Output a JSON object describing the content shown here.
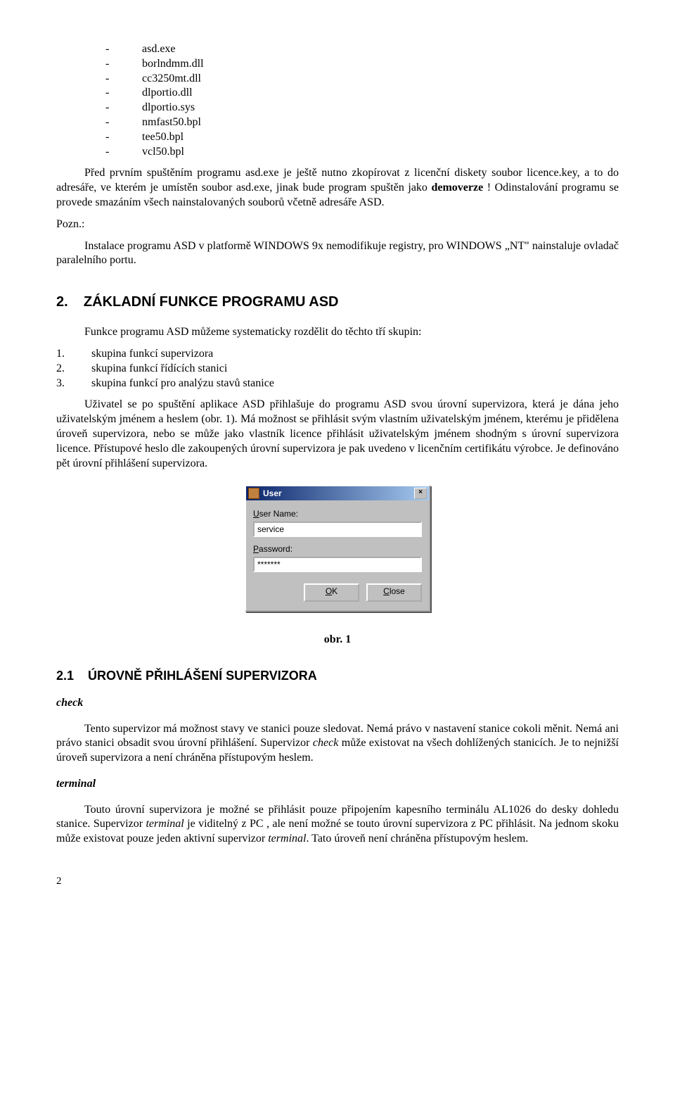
{
  "file_list": [
    "asd.exe",
    "borlndmm.dll",
    "cc3250mt.dll",
    "dlportio.dll",
    "dlportio.sys",
    "nmfast50.bpl",
    "tee50.bpl",
    "vcl50.bpl"
  ],
  "para1_a": "Před prvním spuštěním programu asd.exe je ještě nutno zkopírovat z licenční diskety soubor licence.key, a to do adresáře, ve kterém je umístěn soubor asd.exe, jinak bude program spuštěn jako ",
  "para1_bold": "demoverze",
  "para1_b": " ! Odinstalování programu se provede smazáním všech nainstalovaných souborů včetně adresáře ASD.",
  "pozn": "Pozn.:",
  "para2": "Instalace programu ASD v platformě WINDOWS 9x nemodifikuje registry, pro WINDOWS „NT\" nainstaluje ovladač paralelního portu.",
  "section2_num": "2.",
  "section2_title": "ZÁKLADNÍ FUNKCE PROGRAMU ASD",
  "intro_groups": "Funkce programu ASD můžeme systematicky rozdělit do těchto tří skupin:",
  "group_items": [
    "skupina funkcí supervizora",
    "skupina funkcí řídících stanici",
    "skupina funkcí pro analýzu stavů stanice"
  ],
  "para3": "Uživatel se po spuštění aplikace ASD přihlašuje do programu ASD svou úrovní supervizora, která je dána jeho uživatelským jménem a heslem (obr. 1). Má možnost se přihlásit svým vlastním uživatelským jménem, kterému je přidělena úroveň supervizora, nebo se může jako vlastník licence přihlásit uživatelským jménem shodným s úrovní supervizora licence. Přístupové heslo dle zakoupených úrovní supervizora je pak uvedeno v licenčním certifikátu výrobce. Je definováno pět úrovní přihlášení supervizora.",
  "dialog": {
    "title": "User",
    "username_label_u": "U",
    "username_label_rest": "ser Name:",
    "username_value": "service",
    "password_label_u": "P",
    "password_label_rest": "assword:",
    "password_value": "*******",
    "ok_u": "O",
    "ok_rest": "K",
    "close_u": "C",
    "close_rest": "lose",
    "close_x": "×"
  },
  "caption1": "obr. 1",
  "section21_num": "2.1",
  "section21_title": "ÚROVNĚ PŘIHLÁŠENÍ SUPERVIZORA",
  "check_head": "check",
  "check_text_a": "Tento supervizor má možnost stavy ve stanici pouze sledovat. Nemá právo v nastavení stanice cokoli měnit. Nemá ani právo stanici obsadit svou úrovní přihlášení. Supervizor ",
  "check_text_i": "check",
  "check_text_b": " může existovat na všech dohlížených stanicích. Je to nejnižší úroveň supervizora a není chráněna přístupovým heslem.",
  "terminal_head": "terminal",
  "terminal_text_a": "Touto úrovní supervizora je možné se přihlásit pouze připojením kapesního terminálu AL1026 do desky dohledu stanice. Supervizor ",
  "terminal_text_i1": "terminal",
  "terminal_text_b": " je viditelný z PC , ale není možné se touto úrovní supervizora z PC přihlásit. Na jednom skoku může existovat pouze jeden aktivní supervizor ",
  "terminal_text_i2": "terminal",
  "terminal_text_c": ". Tato úroveň není chráněna přístupovým heslem.",
  "page_number": "2"
}
